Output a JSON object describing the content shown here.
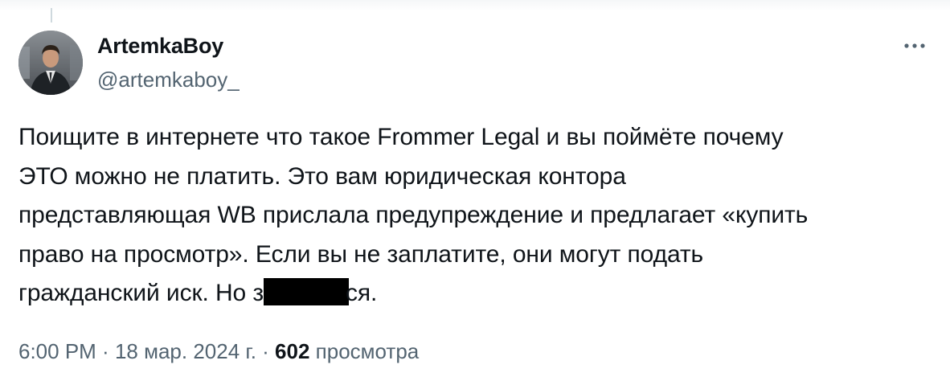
{
  "author": {
    "display_name": "ArtemkaBoy",
    "handle": "@artemkaboy_"
  },
  "menu": {
    "more_icon": "more-horizontal-icon",
    "more_label": "•••"
  },
  "tweet": {
    "lines": [
      "Поищите в интернете что такое Frommer Legal и вы поймёте почему",
      "ЭТО можно не платить. Это вам юридическая контора",
      "представляющая WB прислала предупреждение и предлагает «купить",
      "право на просмотр». Если вы не заплатите, они могут подать"
    ],
    "last_line_before_redaction": "гражданский иск. Но з",
    "last_line_after_redaction": "ся."
  },
  "meta": {
    "time": "6:00 PM",
    "separator": " · ",
    "date": "18 мар. 2024 г.",
    "views_count": "602",
    "views_label": "просмотра"
  },
  "colors": {
    "text": "#0f1419",
    "secondary": "#536471",
    "redaction": "#000000"
  }
}
